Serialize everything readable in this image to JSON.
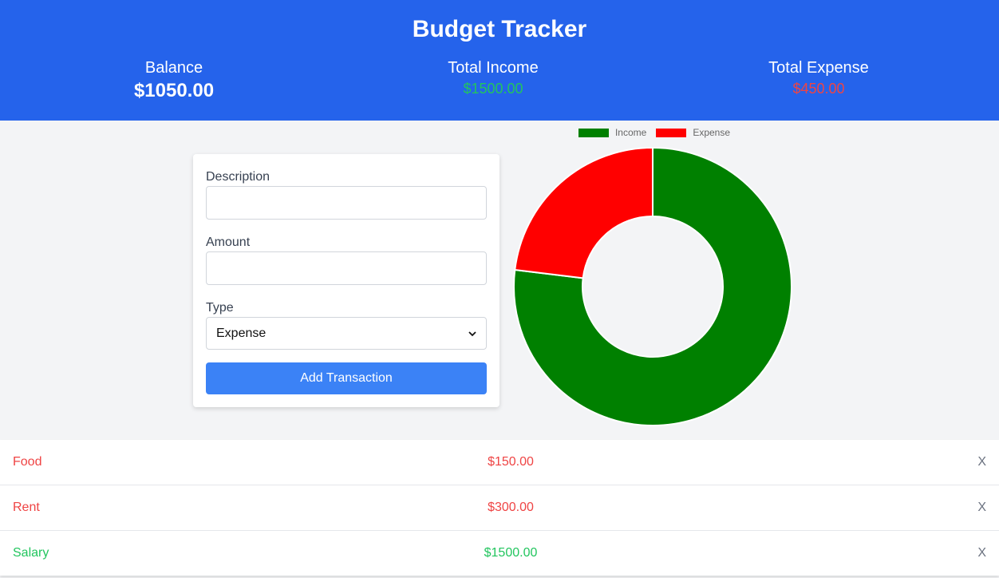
{
  "header": {
    "title": "Budget Tracker",
    "balance_label": "Balance",
    "balance_value": "$1050.00",
    "income_label": "Total Income",
    "income_value": "$1500.00",
    "expense_label": "Total Expense",
    "expense_value": "$450.00"
  },
  "form": {
    "description_label": "Description",
    "description_value": "",
    "amount_label": "Amount",
    "amount_value": "",
    "type_label": "Type",
    "type_selected": "Expense",
    "submit_label": "Add Transaction"
  },
  "chart_data": {
    "type": "pie",
    "categories": [
      "Income",
      "Expense"
    ],
    "values": [
      1500,
      450
    ],
    "colors": [
      "#008000",
      "#ff0000"
    ],
    "legend": "top",
    "donut": true
  },
  "transactions": [
    {
      "description": "Food",
      "amount": "$150.00",
      "type": "expense",
      "delete_label": "X"
    },
    {
      "description": "Rent",
      "amount": "$300.00",
      "type": "expense",
      "delete_label": "X"
    },
    {
      "description": "Salary",
      "amount": "$1500.00",
      "type": "income",
      "delete_label": "X"
    }
  ],
  "colors": {
    "header_bg": "#2563eb",
    "income": "#22c55e",
    "expense": "#ef4444",
    "button": "#3b82f6"
  },
  "icons": {
    "select_arrow": "chevron-down-icon"
  }
}
